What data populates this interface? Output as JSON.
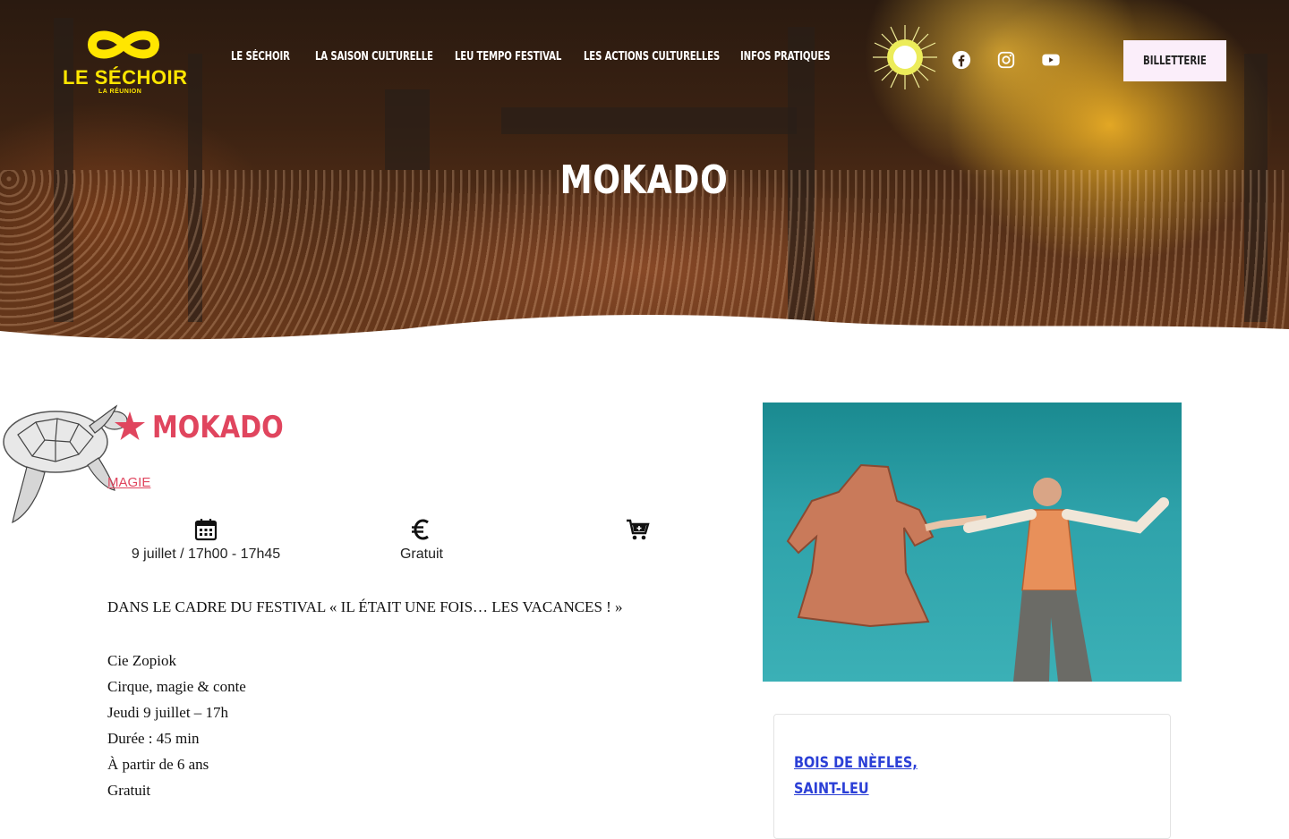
{
  "brand": {
    "name": "LE SÉCHOIR",
    "tagline": "LA RÉUNION",
    "accent": "#ffe600"
  },
  "nav": {
    "items": [
      {
        "label": "LE SÉCHOIR"
      },
      {
        "label": "LA SAISON CULTURELLE"
      },
      {
        "label": "LEU TEMPO FESTIVAL"
      },
      {
        "label": "LES ACTIONS CULTURELLES"
      },
      {
        "label": "INFOS PRATIQUES"
      }
    ]
  },
  "social": {
    "icons": [
      "facebook-icon",
      "instagram-icon",
      "youtube-icon"
    ]
  },
  "ticket_button": {
    "label": "BILLETTERIE",
    "bg": "#fbeefa"
  },
  "hero": {
    "title": "MOKADO"
  },
  "event": {
    "title": "MOKADO",
    "title_color": "#e0455e",
    "category": "MAGIE",
    "date": "9 juillet / 17h00 - 17h45",
    "price": "Gratuit",
    "icons": [
      "calendar-icon",
      "euro-icon",
      "cart-icon"
    ]
  },
  "description": {
    "lead": "DANS LE CADRE DU FESTIVAL « IL ÉTAIT UNE FOIS… LES VACANCES ! »",
    "lines": [
      "Cie Zopiok",
      "Cirque, magie & conte",
      "Jeudi 9 juillet – 17h",
      "Durée : 45 min",
      "À partir de 6 ans",
      "Gratuit"
    ]
  },
  "venue": {
    "line1": "BOIS DE NÈFLES,",
    "line2": "SAINT-LEU",
    "color": "#2b3fd6"
  }
}
